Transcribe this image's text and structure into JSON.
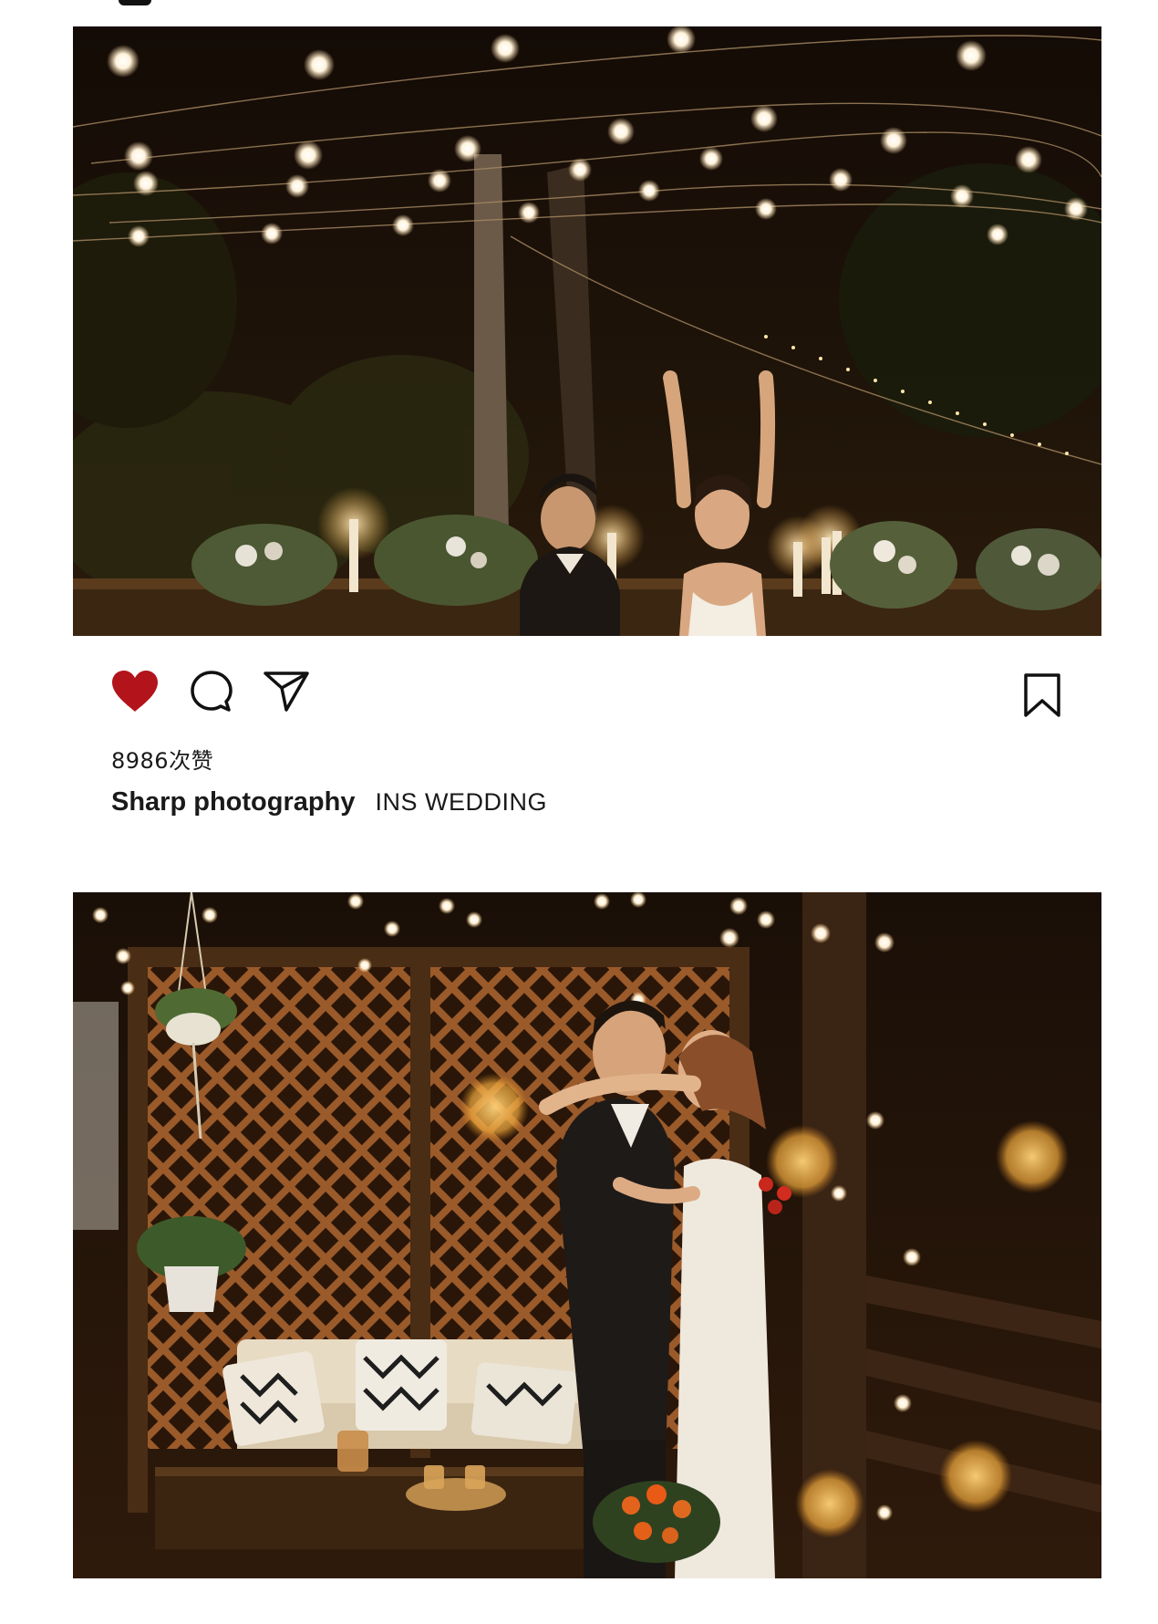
{
  "post": {
    "likes_text": "8986次赞",
    "author": "Sharp photography",
    "caption": "INS WEDDING"
  },
  "actions": {
    "like_icon": "heart-filled-icon",
    "comment_icon": "speech-bubble-icon",
    "share_icon": "paper-plane-icon",
    "save_icon": "bookmark-icon"
  },
  "photos": [
    {
      "name": "couple-celebrating-under-string-lights"
    },
    {
      "name": "couple-embracing-on-patio"
    }
  ],
  "colors": {
    "like": "#b3141c",
    "icon": "#111111",
    "text": "#1a1a1a",
    "background": "#ffffff"
  }
}
